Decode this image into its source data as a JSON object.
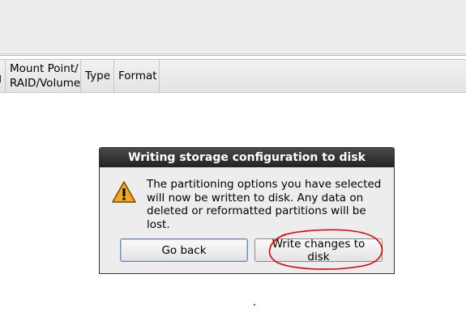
{
  "columns": {
    "mount_point": "Mount Point/\nRAID/Volume",
    "type": "Type",
    "format": "Format"
  },
  "dialog": {
    "title": "Writing storage configuration to disk",
    "icon": "warning-icon",
    "message": "The partitioning options you have selected\nwill now be written to disk.  Any data on\ndeleted or reformatted partitions will be lost.",
    "buttons": {
      "go_back": "Go back",
      "write_changes": "Write changes to disk"
    }
  },
  "colors": {
    "annotation": "#e00000",
    "title_bar": "#2c2c2c",
    "warning_fill": "#f5a623"
  }
}
